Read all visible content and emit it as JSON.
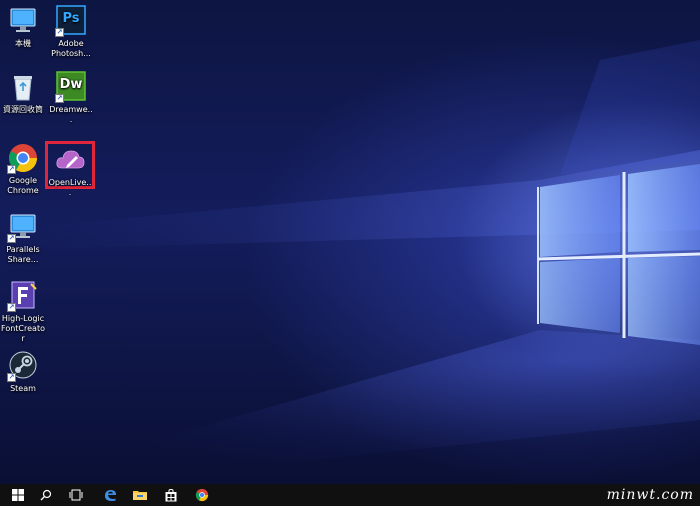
{
  "desktop": {
    "icons": [
      {
        "id": "this-pc",
        "label": "本機"
      },
      {
        "id": "photoshop",
        "label": "Adobe Photosh...",
        "badge": "Ps",
        "color": "#0e1f3a",
        "badge_color": "#31a8ff"
      },
      {
        "id": "recycle-bin",
        "label": "資源回收筒"
      },
      {
        "id": "dreamweaver",
        "label": "Dreamwe...",
        "badge": "Dw",
        "color": "#1f3a12",
        "badge_color": "#5ec233"
      },
      {
        "id": "chrome",
        "label": "Google Chrome"
      },
      {
        "id": "openlive",
        "label": "OpenLive..."
      },
      {
        "id": "parallels",
        "label": "Parallels Share..."
      },
      {
        "id": "fontcreator",
        "label": "High-Logic FontCreator"
      },
      {
        "id": "steam",
        "label": "Steam"
      }
    ],
    "highlight_color": "#e0263b"
  },
  "taskbar": {
    "items": [
      "start-icon",
      "search-icon",
      "task-view-icon",
      "edge-icon",
      "file-explorer-icon",
      "store-icon",
      "chrome-icon"
    ],
    "watermark": "minwt.com"
  }
}
